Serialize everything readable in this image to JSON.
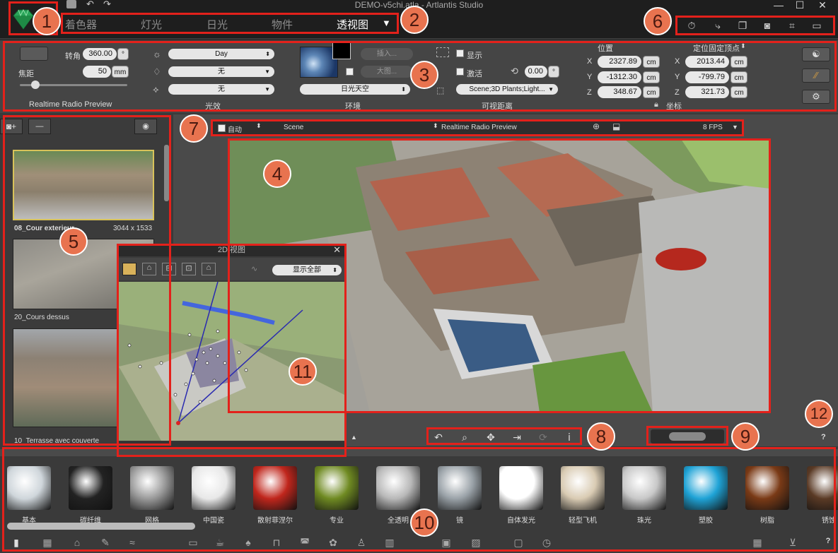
{
  "window": {
    "title": "DEMO-v5chi.atla - Artlantis Studio",
    "minimize": "—",
    "maximize": "☐",
    "close": "✕"
  },
  "tabs": [
    {
      "label": "着色器"
    },
    {
      "label": "灯光"
    },
    {
      "label": "日光"
    },
    {
      "label": "物件"
    },
    {
      "label": "透视图"
    }
  ],
  "tab_dropdown": "▼",
  "toolbar_icons": [
    "timer-icon",
    "axes-icon",
    "copy-icon",
    "camera-icon",
    "crop-icon",
    "monitor-icon"
  ],
  "settings": {
    "camera": {
      "angle_label": "转角",
      "angle_value": "360.00",
      "angle_unit": "°",
      "focal_label": "焦距",
      "focal_value": "50",
      "focal_unit": "mm",
      "section": "Realtime Radio Preview"
    },
    "lighting": {
      "options": [
        "Day",
        "无",
        "无"
      ],
      "section": "光效"
    },
    "environment": {
      "insert_button": "插入...",
      "large_button": "大图...",
      "sky_select": "日光天空",
      "section": "环境"
    },
    "visibility": {
      "show_label": "显示",
      "activate_label": "激活",
      "activate_value": "0.00",
      "activate_unit": "°",
      "layers_select": "Scene;3D Plants;Light...",
      "section": "可视距离"
    },
    "coordinates": {
      "position_label": "位置",
      "target_label": "定位固定顶点",
      "x_label": "X",
      "y_label": "Y",
      "z_label": "Z",
      "pos_x": "2327.89",
      "pos_y": "-1312.30",
      "pos_z": "348.67",
      "target_x": "2013.44",
      "target_y": "-799.79",
      "target_z": "321.73",
      "unit": "cm",
      "section": "坐标"
    }
  },
  "left_panel": {
    "add_button": "+",
    "remove_button": "—",
    "views": [
      {
        "name": "08_Cour exterieur",
        "size": "3044 x 1533"
      },
      {
        "name": "20_Cours dessus",
        "size": ""
      },
      {
        "name": "10_Terrasse avec couverte",
        "size": ""
      }
    ]
  },
  "viewport_toolbar": {
    "auto_label": "自动",
    "scene_label": "Scene",
    "preview_label": "Realtime Radio Preview",
    "fps_label": "8 FPS"
  },
  "view2d": {
    "title": "2D 视图",
    "close": "✕",
    "display_all": "显示全部",
    "help": "?"
  },
  "nav": {
    "help": "?"
  },
  "materials": [
    {
      "label": "基本",
      "color": "#cfd6db"
    },
    {
      "label": "碳纤维",
      "color": "#222222"
    },
    {
      "label": "网格",
      "color": "#9a9a9a"
    },
    {
      "label": "中国瓷",
      "color": "#e8e8e8"
    },
    {
      "label": "散射菲涅尔",
      "color": "#c0261c"
    },
    {
      "label": "专业",
      "color": "#6f8a22"
    },
    {
      "label": "全透明",
      "color": "#b8b8b8"
    },
    {
      "label": "镜",
      "color": "#9aa2a8"
    },
    {
      "label": "自体发光",
      "color": "#ffffff"
    },
    {
      "label": "轻型飞机",
      "color": "#d9cbb3"
    },
    {
      "label": "珠光",
      "color": "#c8c8c8"
    },
    {
      "label": "塑胶",
      "color": "#1fa3d6"
    },
    {
      "label": "树脂",
      "color": "#7a3a16"
    },
    {
      "label": "锈蚀",
      "color": "#5a3a25"
    }
  ],
  "callouts": [
    "1",
    "2",
    "3",
    "4",
    "5",
    "6",
    "7",
    "8",
    "9",
    "10",
    "11",
    "12"
  ],
  "colors": {
    "accent_red": "#e3211b",
    "callout": "#e8734f",
    "panel": "#454545"
  }
}
